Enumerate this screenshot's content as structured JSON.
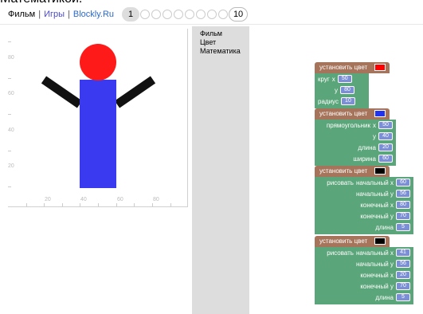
{
  "top_caption": "Математикой.",
  "nav": {
    "film": "Фильм",
    "games": "Игры",
    "brand": "Blockly.Ru",
    "sep1": "|",
    "sep2": "|",
    "current_page": "1",
    "last_page": "10"
  },
  "canvas": {
    "y_labels": [
      "80",
      "60",
      "40",
      "20"
    ],
    "x_labels": [
      "20",
      "40",
      "60",
      "80"
    ],
    "colors": {
      "head": "#ff1a1a",
      "body": "#3a3af0",
      "arms": "#111111"
    }
  },
  "toolbox": {
    "items": [
      "Фильм",
      "Цвет",
      "Математика"
    ]
  },
  "blocks": {
    "set_color_label": "установить цвет",
    "circle": {
      "label": "круг",
      "x_label": "x",
      "y_label": "y",
      "radius_label": "радиус",
      "x": "50",
      "y": "80",
      "radius": "10",
      "color": "#ff0000"
    },
    "rect": {
      "label": "прямоугольник",
      "x_label": "x",
      "y_label": "y",
      "length_label": "длина",
      "width_label": "ширина",
      "x": "50",
      "y": "40",
      "length": "20",
      "width": "60",
      "color": "#2233ee"
    },
    "line1": {
      "label": "рисовать",
      "x1_label": "начальный x",
      "y1_label": "начальный y",
      "x2_label": "конечный x",
      "y2_label": "конечный y",
      "w_label": "длина",
      "x1": "60",
      "y1": "56",
      "x2": "80",
      "y2": "70",
      "w": "5",
      "color": "#000000"
    },
    "line2": {
      "label": "рисовать",
      "x1_label": "начальный x",
      "y1_label": "начальный y",
      "x2_label": "конечный x",
      "y2_label": "конечный y",
      "w_label": "длина",
      "x1": "41",
      "y1": "56",
      "x2": "20",
      "y2": "70",
      "w": "5",
      "color": "#000000"
    }
  }
}
